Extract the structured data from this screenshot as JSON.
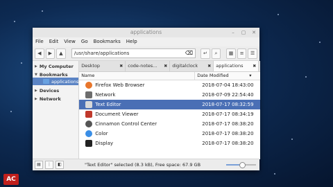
{
  "window": {
    "title": "applications"
  },
  "menu": [
    "File",
    "Edit",
    "View",
    "Go",
    "Bookmarks",
    "Help"
  ],
  "toolbar": {
    "path": "/usr/share/applications"
  },
  "sidebar": {
    "my_computer": "My Computer",
    "bookmarks": "Bookmarks",
    "bookmark_item": "applications",
    "devices": "Devices",
    "network": "Network"
  },
  "tabs": [
    {
      "label": "Desktop",
      "close": "✖"
    },
    {
      "label": "code-notes...",
      "close": "✖"
    },
    {
      "label": "digitalclock",
      "close": "✖"
    },
    {
      "label": "applications",
      "close": "✖"
    }
  ],
  "columns": {
    "name": "Name",
    "date": "Date Modified"
  },
  "files": [
    {
      "name": "Firefox Web Browser",
      "date": "2018-07-04 18:43:00",
      "color": "#e8762b"
    },
    {
      "name": "Network",
      "date": "2018-07-09 22:54:40",
      "color": "#6d6d6d"
    },
    {
      "name": "Text Editor",
      "date": "2018-07-17 08:32:59",
      "color": "#d9d9d9"
    },
    {
      "name": "Document Viewer",
      "date": "2018-07-17 08:34:19",
      "color": "#c0392b"
    },
    {
      "name": "Cinnamon Control Center",
      "date": "2018-07-17 08:38:20",
      "color": "#555555"
    },
    {
      "name": "Color",
      "date": "2018-07-17 08:38:20",
      "color": "#3a8ee6"
    },
    {
      "name": "Display",
      "date": "2018-07-17 08:38:20",
      "color": "#222222"
    }
  ],
  "status": {
    "text": "\"Text Editor\" selected (8.3 kB), Free space: 67.9 GB"
  },
  "logo": "AC"
}
